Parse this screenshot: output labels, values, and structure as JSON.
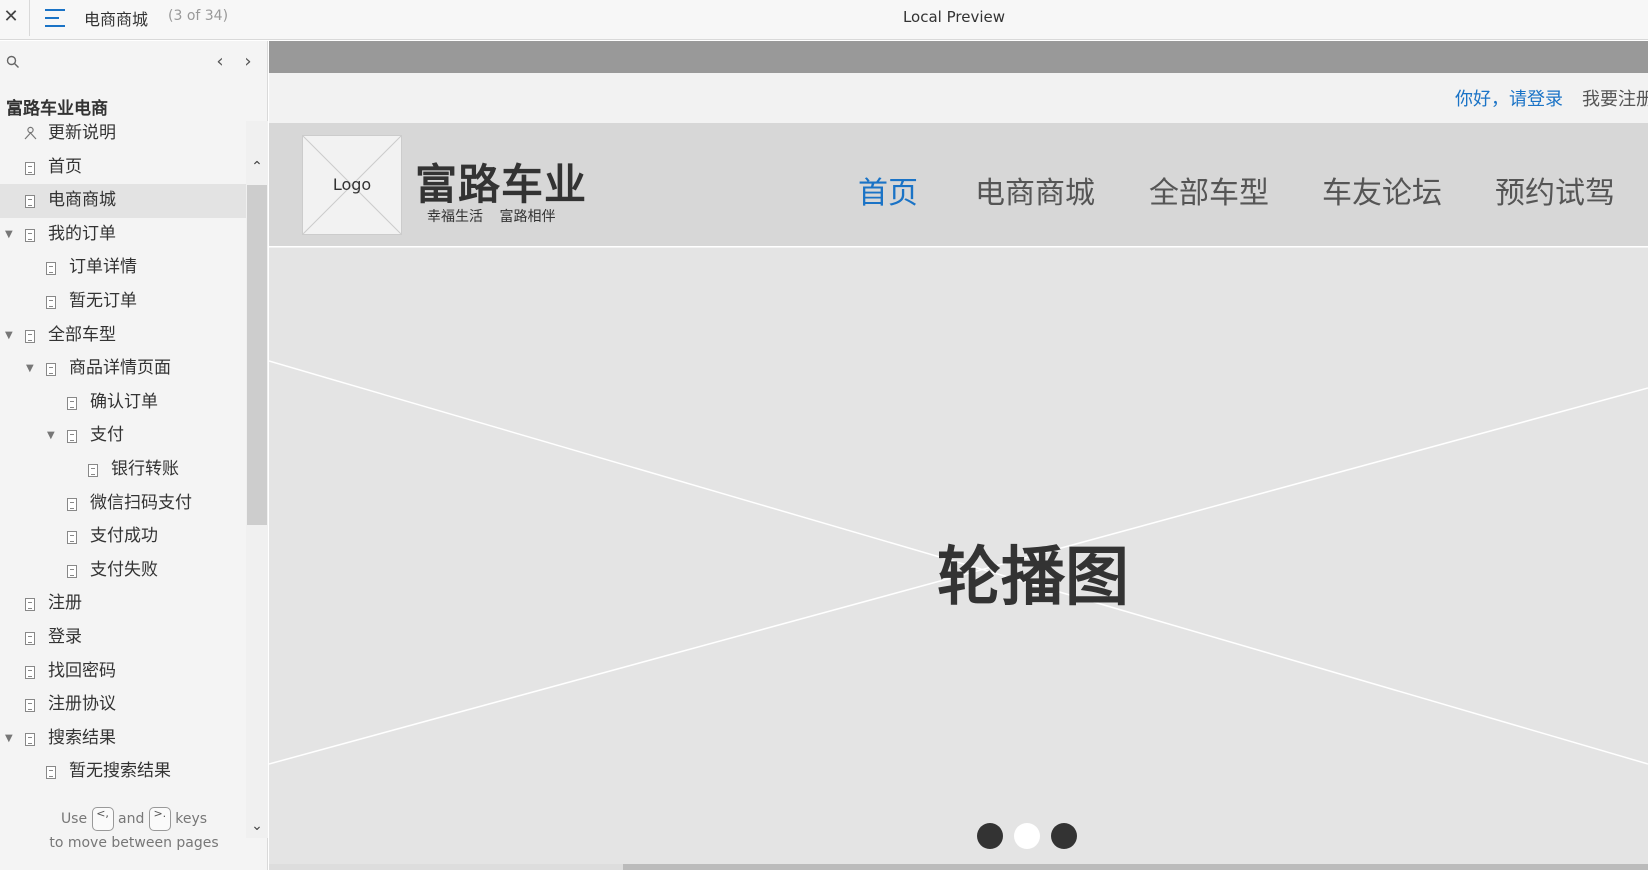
{
  "topbar": {
    "close_label": "✕",
    "page_name": "电商商城",
    "page_count": "(3 of 34)",
    "preview_title": "Local Preview"
  },
  "sidebar": {
    "search": {
      "placeholder": ""
    },
    "prev_label": "‹",
    "next_label": "›",
    "project_title": "富路车业电商",
    "items": [
      {
        "label": "更新说明",
        "icon": "sitemap-icon"
      },
      {
        "label": "首页",
        "icon": "page-icon"
      },
      {
        "label": "电商商城",
        "icon": "page-icon",
        "active": true
      },
      {
        "label": "我的订单",
        "icon": "page-icon",
        "expanded": true
      },
      {
        "label": "订单详情",
        "icon": "page-icon"
      },
      {
        "label": "暂无订单",
        "icon": "page-icon"
      },
      {
        "label": "全部车型",
        "icon": "page-icon",
        "expanded": true
      },
      {
        "label": "商品详情页面",
        "icon": "page-icon",
        "expanded": true
      },
      {
        "label": "确认订单",
        "icon": "page-icon"
      },
      {
        "label": "支付",
        "icon": "page-icon",
        "expanded": true
      },
      {
        "label": "银行转账",
        "icon": "page-icon"
      },
      {
        "label": "微信扫码支付",
        "icon": "page-icon"
      },
      {
        "label": "支付成功",
        "icon": "page-icon"
      },
      {
        "label": "支付失败",
        "icon": "page-icon"
      },
      {
        "label": "注册",
        "icon": "page-icon"
      },
      {
        "label": "登录",
        "icon": "page-icon"
      },
      {
        "label": "找回密码",
        "icon": "page-icon"
      },
      {
        "label": "注册协议",
        "icon": "page-icon"
      },
      {
        "label": "搜索结果",
        "icon": "page-icon",
        "expanded": true
      },
      {
        "label": "暂无搜索结果",
        "icon": "page-icon"
      }
    ],
    "help": {
      "use": "Use",
      "key_prev": "<,",
      "and": "and",
      "key_next": ">.",
      "keys": "keys",
      "line2": "to move between pages"
    }
  },
  "preview": {
    "login_link": "你好，请登录",
    "register_link": "我要注册",
    "logo_text": "Logo",
    "brand_name": "富路车业",
    "brand_slogan": "幸福生活 富路相伴",
    "nav": [
      {
        "label": "首页",
        "active": true
      },
      {
        "label": "电商商城"
      },
      {
        "label": "全部车型"
      },
      {
        "label": "车友论坛"
      },
      {
        "label": "预约试驾"
      }
    ],
    "banner_label": "轮播图",
    "carousel_dots": [
      "active",
      "inactive",
      "active"
    ]
  },
  "colors": {
    "accent": "#1a73c6",
    "header_bg": "#d7d7d7",
    "banner_bg": "#e4e4e4",
    "dot_dark": "#333333",
    "dot_light": "#ffffff"
  }
}
